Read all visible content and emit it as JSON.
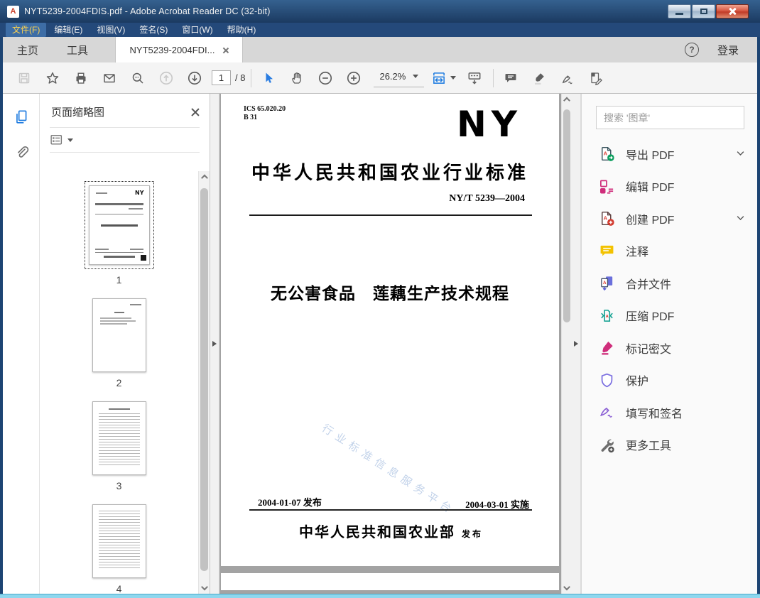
{
  "window": {
    "title": "NYT5239-2004FDIS.pdf - Adobe Acrobat Reader DC (32-bit)"
  },
  "menu": {
    "items": [
      {
        "label": "文件(F)"
      },
      {
        "label": "编辑(E)"
      },
      {
        "label": "视图(V)"
      },
      {
        "label": "签名(S)"
      },
      {
        "label": "窗口(W)"
      },
      {
        "label": "帮助(H)"
      }
    ]
  },
  "tabs": {
    "home": "主页",
    "tools": "工具",
    "document": "NYT5239-2004FDI...",
    "sign_in": "登录"
  },
  "icons": {
    "help_glyph": "?",
    "app_glyph": "A"
  },
  "toolbar": {
    "page_current": "1",
    "page_total": "/ 8",
    "zoom_level": "26.2%"
  },
  "left_panel": {
    "title": "页面缩略图",
    "thumbnails": [
      {
        "page": "1"
      },
      {
        "page": "2"
      },
      {
        "page": "3"
      },
      {
        "page": "4"
      }
    ]
  },
  "document": {
    "ics_line1": "ICS 65.020.20",
    "ics_line2": "B 31",
    "logo": "NY",
    "standard_heading": "中华人民共和国农业行业标准",
    "standard_number": "NY/T 5239—2004",
    "title": "无公害食品　莲藕生产技术规程",
    "watermark": "行业标准信息服务平台",
    "issue_date": "2004-01-07 发布",
    "implement_date": "2004-03-01 实施",
    "issuer": "中华人民共和国农业部",
    "issuer_suffix": "发 布"
  },
  "right_panel": {
    "search_placeholder": "搜索 '图章'",
    "tools": [
      {
        "label": "导出 PDF",
        "chevron": true
      },
      {
        "label": "编辑 PDF",
        "chevron": false
      },
      {
        "label": "创建 PDF",
        "chevron": true
      },
      {
        "label": "注释",
        "chevron": false
      },
      {
        "label": "合并文件",
        "chevron": false
      },
      {
        "label": "压缩 PDF",
        "chevron": false
      },
      {
        "label": "标记密文",
        "chevron": false
      },
      {
        "label": "保护",
        "chevron": false
      },
      {
        "label": "填写和签名",
        "chevron": false
      },
      {
        "label": "更多工具",
        "chevron": false
      }
    ]
  },
  "colors": {
    "accent_blue": "#1f7ce0",
    "titlebar_blue": "#1d4473",
    "close_red": "#c9402c",
    "viewer_gray": "#a3a3a3"
  }
}
